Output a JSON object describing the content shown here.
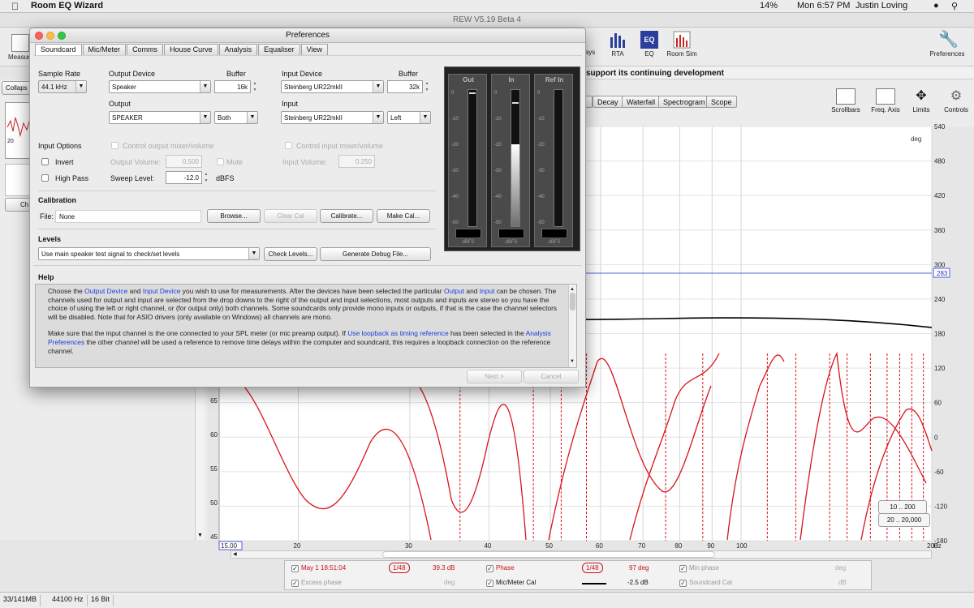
{
  "menubar": {
    "app_name": "Room EQ Wizard",
    "battery": "14%",
    "clock": "Mon 6:57 PM",
    "user": "Justin Loving"
  },
  "window": {
    "title": "REW V5.19 Beta 4"
  },
  "toolbar": {
    "measure_label": "Measure",
    "eq_label": "EQ",
    "rta_label": "RTA",
    "eq_btn_label": "EQ",
    "roomsim_label": "Room Sim",
    "prefs_label": "Preferences",
    "hidden_partial": "ays"
  },
  "banner": {
    "text": "support its continuing development"
  },
  "graph_tabs": [
    "Decay",
    "Waterfall",
    "Spectrogram",
    "Scope"
  ],
  "graph_controls": [
    "Scrollbars",
    "Freq. Axis",
    "Limits",
    "Controls"
  ],
  "left_panel": {
    "collapse_label": "Collaps",
    "mini_axis": "20",
    "chan_label": "Ch"
  },
  "dialog": {
    "title": "Preferences",
    "tabs": [
      "Soundcard",
      "Mic/Meter",
      "Comms",
      "House Curve",
      "Analysis",
      "Equaliser",
      "View"
    ],
    "sample_rate": {
      "label": "Sample Rate",
      "value": "44.1 kHz"
    },
    "output_device": {
      "label": "Output Device",
      "value": "Speaker"
    },
    "out_buffer": {
      "label": "Buffer",
      "value": "16k"
    },
    "output": {
      "label": "Output",
      "value": "SPEAKER",
      "channel": "Both"
    },
    "input_device": {
      "label": "Input Device",
      "value": "Steinberg UR22mkII"
    },
    "in_buffer": {
      "label": "Buffer",
      "value": "32k"
    },
    "input": {
      "label": "Input",
      "value": "Steinberg UR22mkII",
      "channel": "Left"
    },
    "input_options": {
      "label": "Input Options",
      "invert": "Invert",
      "high_pass": "High Pass",
      "ctrl_out_mixer": "Control output mixer/volume",
      "ctrl_in_mixer": "Control input mixer/volume",
      "out_volume_label": "Output Volume:",
      "out_volume": "0.500",
      "mute": "Mute",
      "in_volume_label": "Input Volume:",
      "in_volume": "0.250",
      "sweep_label": "Sweep Level:",
      "sweep_value": "-12.0",
      "sweep_unit": "dBFS"
    },
    "calibration": {
      "label": "Calibration",
      "file_label": "File:",
      "file_value": "None",
      "browse": "Browse...",
      "clear_cal": "Clear Cal",
      "calibrate": "Calibrate...",
      "make_cal": "Make Cal..."
    },
    "levels": {
      "label": "Levels",
      "select": "Use main speaker test signal to check/set levels",
      "check": "Check Levels...",
      "debug": "Generate Debug File..."
    },
    "meters": [
      {
        "name": "Out",
        "fill": 0.0,
        "peak": 0.98
      },
      {
        "name": "In",
        "fill": 0.6,
        "peak": 0.91
      },
      {
        "name": "Ref In",
        "fill": 0.0,
        "peak": 0.0
      }
    ],
    "meter_scale": [
      "0",
      "-10",
      "-20",
      "-30",
      "-40",
      "-50"
    ],
    "meter_unit": "dBFS",
    "help": {
      "label": "Help",
      "p1_a": "Choose the ",
      "k1": "Output Device",
      "p1_b": " and ",
      "k2": "Input Device",
      "p1_c": " you wish to use for measurements. After the devices have been selected the particular ",
      "k3": "Output",
      "p1_d": " and ",
      "k4": "Input",
      "p1_e": " can be chosen. The channels used for output and input are selected from the drop downs to the right of the output and input selections, most outputs and inputs are stereo so you have the choice of using the left or right channel, or (for output only) both channels. Some soundcards only provide mono inputs or outputs, if that is the case the channel selectors will be disabled. Note that for ASIO drivers (only available on Windows) all channels are mono.",
      "p2_a": "Make sure that the input channel is the one connected to your SPL meter (or mic preamp output). If ",
      "k5": "Use loopback as timing reference",
      "p2_b": " has been selected in the ",
      "k6": "Analysis Preferences",
      "p2_c": " the other channel will be used a reference to remove time delays within the computer and soundcard, this requires a loopback connection on the reference channel."
    },
    "next": "Next >",
    "cancel": "Cancel"
  },
  "plot": {
    "left_axis": [
      "65",
      "60",
      "55",
      "50",
      "45"
    ],
    "right_axis_unit": "deg",
    "right_axis": [
      "540",
      "480",
      "420",
      "360",
      "300",
      "240",
      "180",
      "120",
      "60",
      "0",
      "-60",
      "-120",
      "-180"
    ],
    "cursor_value": "283",
    "x_axis": [
      "15.00",
      "20",
      "30",
      "40",
      "50",
      "60",
      "70",
      "80",
      "90",
      "100",
      "200"
    ],
    "x_unit": "Hz",
    "range_btn1": "10 .. 200",
    "range_btn2": "20 .. 20,000",
    "colors": {
      "trace": "#d8141c",
      "mic": "#000000",
      "cursor": "#4d5de6"
    }
  },
  "legend": {
    "meas_name": "May 1 18:51:04",
    "smoothing": "1/48",
    "meas_value": "39.3 dB",
    "phase": "Phase",
    "phase_smoothing": "1/48",
    "phase_value": "97 deg",
    "min_phase": "Min phase",
    "min_phase_unit": "deg",
    "excess_phase": "Excess phase",
    "excess_unit": "deg",
    "mic_cal": "Mic/Meter Cal",
    "mic_value": "-2.5 dB",
    "sc_cal": "Soundcard Cal",
    "sc_unit": "dB"
  },
  "status": {
    "memory": "33/141MB",
    "rate": "44100 Hz",
    "bits": "16 Bit"
  }
}
